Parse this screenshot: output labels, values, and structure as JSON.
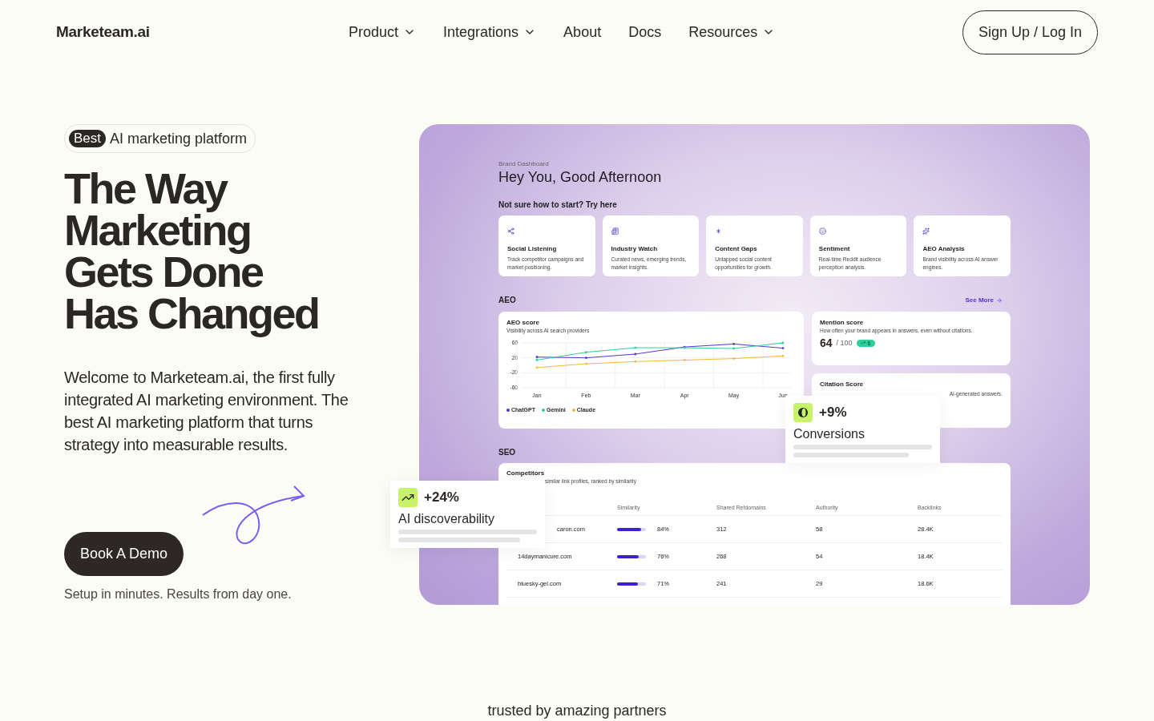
{
  "nav": {
    "logo": "Marketeam.ai",
    "links": [
      {
        "label": "Product",
        "dropdown": true
      },
      {
        "label": "Integrations",
        "dropdown": true
      },
      {
        "label": "About",
        "dropdown": false
      },
      {
        "label": "Docs",
        "dropdown": false
      },
      {
        "label": "Resources",
        "dropdown": true
      }
    ],
    "cta": "Sign Up / Log In"
  },
  "hero": {
    "badge": {
      "tag": "Best",
      "text": "AI marketing platform"
    },
    "headline": [
      "The Way",
      "Marketing",
      "Gets Done",
      "Has Changed"
    ],
    "description": "Welcome to Marketeam.ai, the first fully integrated AI marketing environment. The best AI marketing platform that turns strategy into measurable results.",
    "button": "Book A Demo",
    "note": "Setup in minutes. Results from day one."
  },
  "dashboard": {
    "eyebrow": "Brand Dashboard",
    "title": "Hey You, Good Afternoon",
    "prompt": "Not sure how to start? Try here",
    "quick_starts": [
      {
        "title": "Social Listening",
        "text": "Track competitor campaigns and market positioning."
      },
      {
        "title": "Industry Watch",
        "text": "Curated news, emerging trends, market insights."
      },
      {
        "title": "Content Gaps",
        "text": "Untapped social content opportunities for growth."
      },
      {
        "title": "Sentiment",
        "text": "Real-time Reddit audience perception analysis."
      },
      {
        "title": "AEO Analysis",
        "text": "Brand visibility across AI answer engines."
      }
    ],
    "aeo": {
      "heading": "AEO",
      "see_more": "See More",
      "score_card": {
        "title": "AEO score",
        "subtitle": "Visibility across AI search providers",
        "chart_data": {
          "type": "line",
          "categories": [
            "Jan",
            "Feb",
            "Mar",
            "Apr",
            "May",
            "Jun"
          ],
          "yticks": [
            60,
            20,
            -20,
            -60
          ],
          "ylim": [
            -60,
            60
          ],
          "grid": true,
          "series": [
            {
              "name": "ChatGPT",
              "color": "#4f35d4",
              "values": [
                22,
                20,
                30,
                49,
                57,
                46
              ]
            },
            {
              "name": "Gemini",
              "color": "#2ecf9a",
              "values": [
                14,
                35,
                47,
                47,
                45,
                60
              ]
            },
            {
              "name": "Claude",
              "color": "#f5b73b",
              "values": [
                -6,
                4,
                10,
                14,
                18,
                25
              ]
            }
          ]
        }
      },
      "mention": {
        "title": "Mention score",
        "subtitle": "How often your brand appears in answers, even without citations.",
        "score": "64",
        "total": "/ 100",
        "change": "6"
      },
      "citation": {
        "title": "Citation Score",
        "subtitle": "AI-generated answers."
      }
    },
    "seo": {
      "heading": "SEO",
      "card": {
        "title": "Competitors",
        "subtitle": "similar link profiles, ranked by similarity",
        "columns": [
          "Similarity",
          "Shared Refdomains",
          "Authority",
          "Backlinks"
        ],
        "rows": [
          {
            "domain": "caron.com",
            "similarity": "84%",
            "level": 0.84,
            "refdomains": "312",
            "authority": "58",
            "backlinks": "28.4K"
          },
          {
            "domain": "14daymanicure.com",
            "similarity": "76%",
            "level": 0.76,
            "refdomains": "268",
            "authority": "54",
            "backlinks": "18.4K"
          },
          {
            "domain": "bluesky-gel.com",
            "similarity": "71%",
            "level": 0.71,
            "refdomains": "241",
            "authority": "29",
            "backlinks": "18.6K"
          }
        ]
      }
    }
  },
  "floating_cards": [
    {
      "value": "+24%",
      "label": "AI discoverability"
    },
    {
      "value": "+9%",
      "label": "Conversions"
    }
  ],
  "partners": {
    "title": "trusted by amazing partners"
  }
}
